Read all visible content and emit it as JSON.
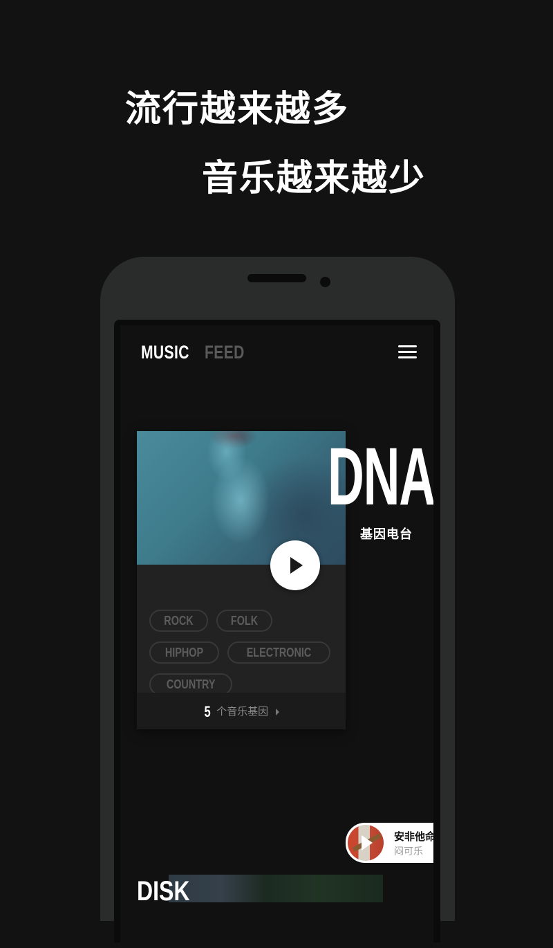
{
  "promo": {
    "line1": "流行越来越多",
    "line2": "音乐越来越少"
  },
  "app": {
    "nav": {
      "tabs": [
        {
          "label": "MUSIC",
          "active": true
        },
        {
          "label": "FEED",
          "active": false
        }
      ],
      "menu_icon": "hamburger-menu-icon"
    },
    "dna_card": {
      "title": "DNA",
      "subtitle": "基因电台",
      "play_icon": "play-icon",
      "tags": [
        "ROCK",
        "FOLK",
        "HIPHOP",
        "ELECTRONIC",
        "COUNTRY"
      ],
      "gene_count": "5",
      "gene_label": "个音乐基因"
    },
    "next_section": {
      "title": "DISK"
    },
    "mini_player": {
      "song_title": "安非他命",
      "artist": "闷可乐",
      "play_icon": "play-icon"
    }
  },
  "colors": {
    "background": "#121212",
    "phone_body": "#2a2b2b",
    "card": "#222222",
    "inactive_tab": "#5a5a5a"
  }
}
